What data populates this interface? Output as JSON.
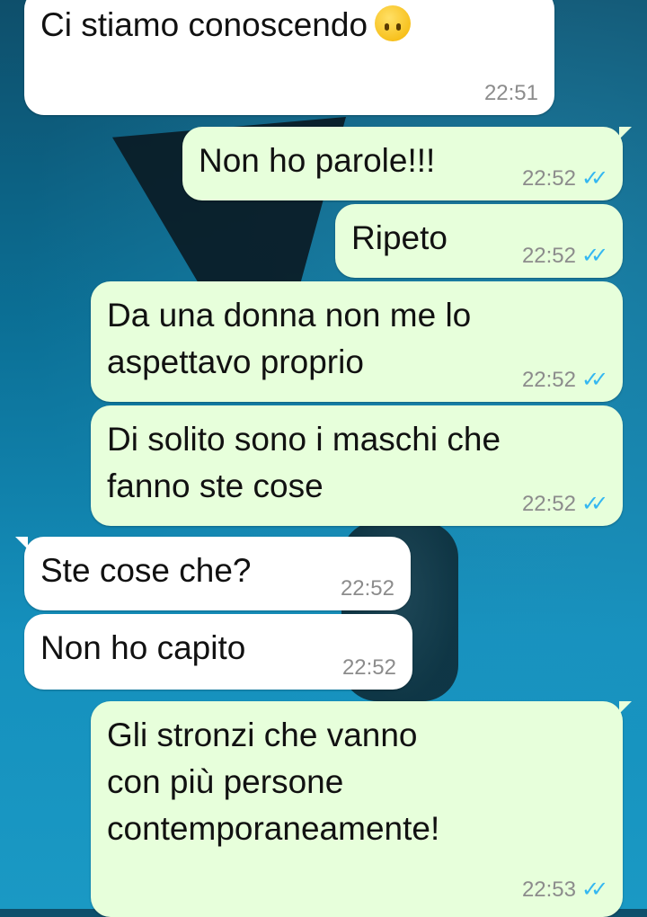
{
  "messages": [
    {
      "direction": "incoming",
      "text": "Ci stiamo conoscendo",
      "emoji": "upside-down-face",
      "time": "22:51"
    },
    {
      "direction": "outgoing",
      "text": "Non ho parole!!!",
      "time": "22:52",
      "status": "read"
    },
    {
      "direction": "outgoing",
      "text": "Ripeto",
      "time": "22:52",
      "status": "read"
    },
    {
      "direction": "outgoing",
      "text": "Da una donna non me lo\naspettavo proprio",
      "time": "22:52",
      "status": "read"
    },
    {
      "direction": "outgoing",
      "text": "Di solito sono i maschi che\nfanno ste cose",
      "time": "22:52",
      "status": "read"
    },
    {
      "direction": "incoming",
      "text": "Ste cose che?",
      "time": "22:52"
    },
    {
      "direction": "incoming",
      "text": "Non ho capito",
      "time": "22:52"
    },
    {
      "direction": "outgoing",
      "text": "Gli stronzi che vanno\ncon più persone\ncontemporaneamente!",
      "time": "22:53",
      "status": "read"
    }
  ],
  "colors": {
    "incoming_bubble": "#ffffff",
    "outgoing_bubble": "#e7ffdb",
    "read_ticks": "#34b7f1",
    "timestamp": "#8c8c8c"
  },
  "icons": {
    "read_status": "double-check-icon",
    "emoji": "upside-down-face-emoji"
  }
}
